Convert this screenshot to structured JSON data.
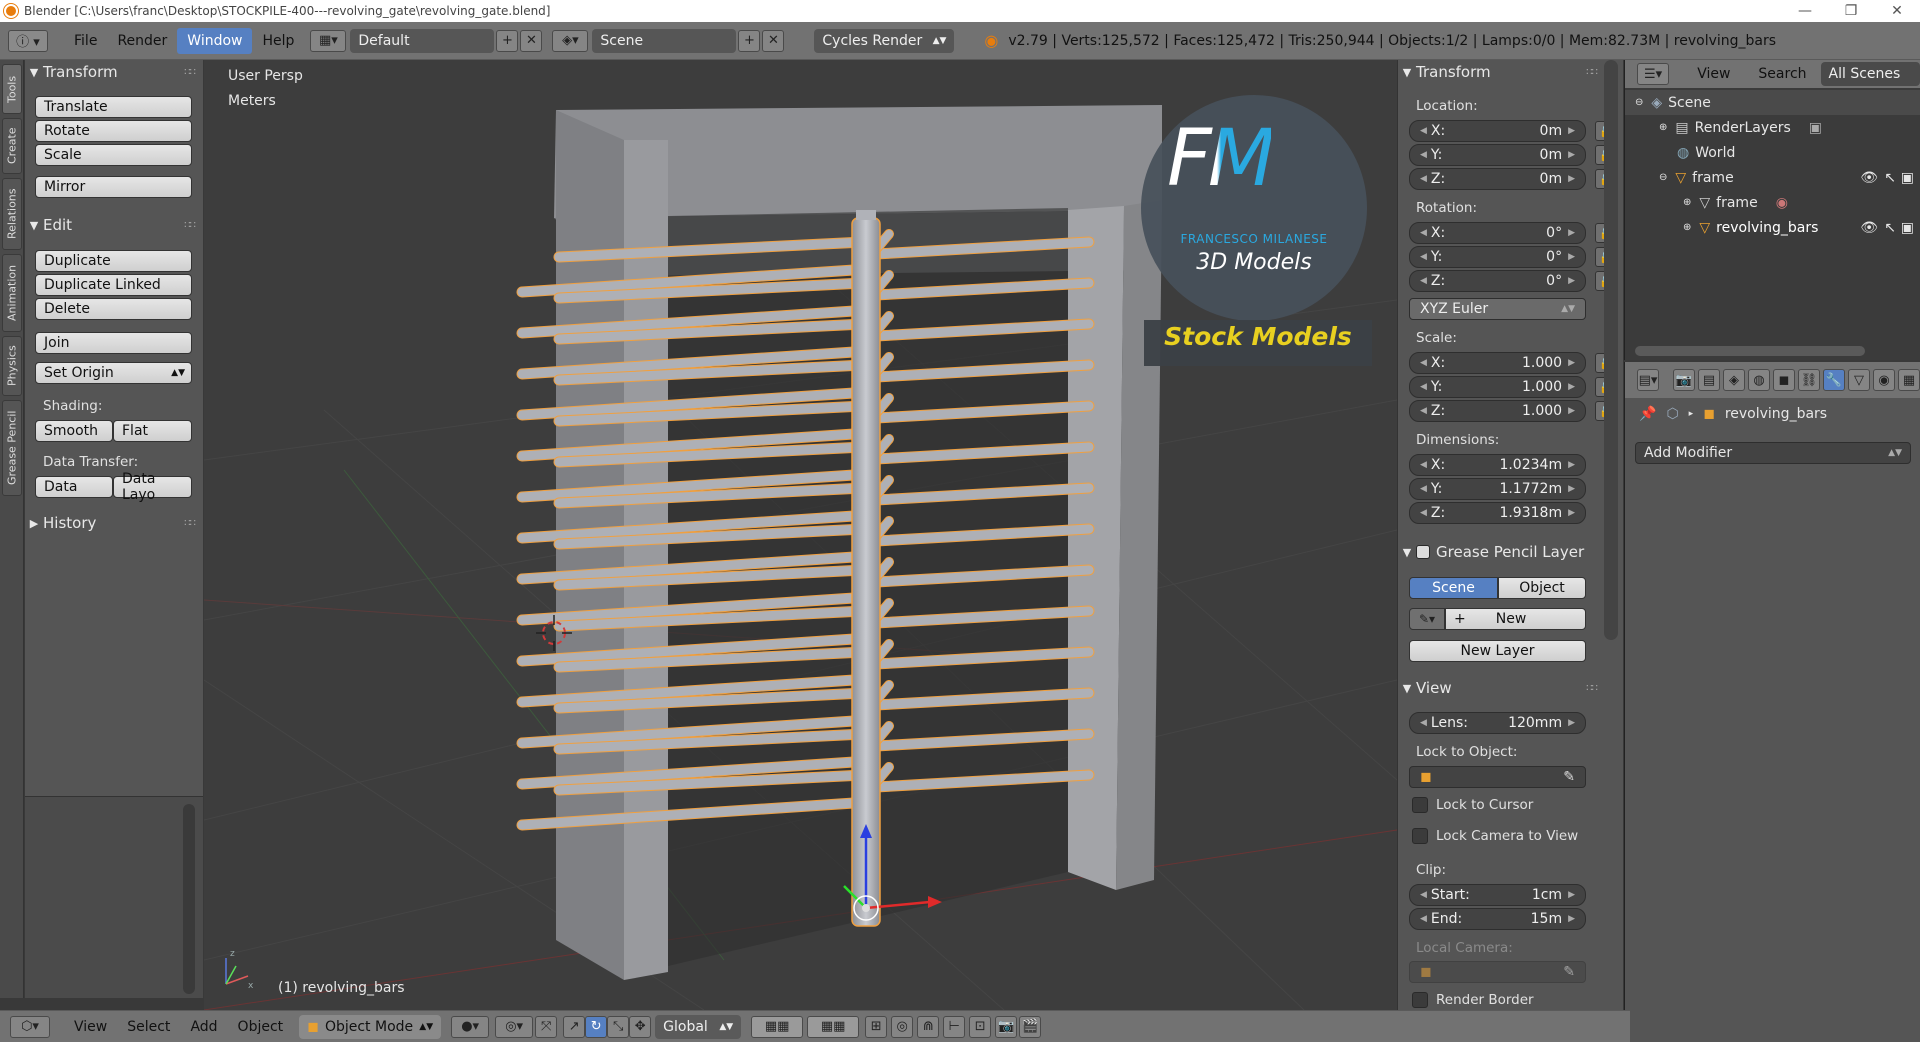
{
  "window": {
    "title": "Blender [C:\\Users\\franc\\Desktop\\STOCKPILE-400---revolving_gate\\revolving_gate.blend]",
    "controls": [
      "—",
      "❐",
      "✕"
    ]
  },
  "infobar": {
    "menus": [
      "File",
      "Render",
      "Window",
      "Help"
    ],
    "active_menu": "Window",
    "screen_layout": "Default",
    "scene": "Scene",
    "render_engine": "Cycles Render",
    "stats": "v2.79 | Verts:125,572 | Faces:125,472 | Tris:250,944 | Objects:1/2 | Lamps:0/0 | Mem:82.73M | revolving_bars"
  },
  "tool_tabs": [
    "Tools",
    "Create",
    "Relations",
    "Animation",
    "Physics",
    "Grease Pencil"
  ],
  "tools": {
    "transform_header": "Transform",
    "translate": "Translate",
    "rotate": "Rotate",
    "scale": "Scale",
    "mirror": "Mirror",
    "edit_header": "Edit",
    "duplicate": "Duplicate",
    "duplicate_linked": "Duplicate Linked",
    "delete": "Delete",
    "join": "Join",
    "set_origin": "Set Origin",
    "shading_label": "Shading:",
    "smooth": "Smooth",
    "flat": "Flat",
    "data_transfer_label": "Data Transfer:",
    "data": "Data",
    "data_layout": "Data Layo",
    "history_header": "History"
  },
  "viewport": {
    "view_name": "User Persp",
    "units": "Meters",
    "active_object": "(1) revolving_bars",
    "watermark_initials": "FM",
    "watermark_name": "FRANCESCO MILANESE",
    "watermark_sub": "3D Models",
    "watermark_banner": "Stock Models"
  },
  "bottombar": {
    "menus": [
      "View",
      "Select",
      "Add",
      "Object"
    ],
    "mode": "Object Mode",
    "orientation": "Global"
  },
  "npanel": {
    "transform_header": "Transform",
    "location_label": "Location:",
    "location": [
      {
        "k": "X:",
        "v": "0m"
      },
      {
        "k": "Y:",
        "v": "0m"
      },
      {
        "k": "Z:",
        "v": "0m"
      }
    ],
    "rotation_label": "Rotation:",
    "rotation": [
      {
        "k": "X:",
        "v": "0°"
      },
      {
        "k": "Y:",
        "v": "0°"
      },
      {
        "k": "Z:",
        "v": "0°"
      }
    ],
    "rotation_mode": "XYZ Euler",
    "scale_label": "Scale:",
    "scale": [
      {
        "k": "X:",
        "v": "1.000"
      },
      {
        "k": "Y:",
        "v": "1.000"
      },
      {
        "k": "Z:",
        "v": "1.000"
      }
    ],
    "dimensions_label": "Dimensions:",
    "dimensions": [
      {
        "k": "X:",
        "v": "1.0234m"
      },
      {
        "k": "Y:",
        "v": "1.1772m"
      },
      {
        "k": "Z:",
        "v": "1.9318m"
      }
    ],
    "grease_header": "Grease Pencil Layer",
    "scene_btn": "Scene",
    "object_btn": "Object",
    "new_btn": "New",
    "new_layer_btn": "New Layer",
    "view_header": "View",
    "lens_label": "Lens:",
    "lens_value": "120mm",
    "lock_object_label": "Lock to Object:",
    "lock_cursor": "Lock to Cursor",
    "lock_camera": "Lock Camera to View",
    "clip_label": "Clip:",
    "clip_start_label": "Start:",
    "clip_start": "1cm",
    "clip_end_label": "End:",
    "clip_end": "15m",
    "local_camera_label": "Local Camera:",
    "render_border": "Render Border"
  },
  "outliner": {
    "view": "View",
    "search": "Search",
    "filter": "All Scenes",
    "items": [
      "Scene",
      "RenderLayers",
      "World",
      "frame",
      "frame",
      "revolving_bars"
    ]
  },
  "properties": {
    "object_name": "revolving_bars",
    "add_modifier": "Add Modifier"
  },
  "colors": {
    "accent": "#5680c2",
    "selection_outline": "#f0a040",
    "watermark_cyan": "#2aa9e0",
    "watermark_yellow": "#e8d020"
  }
}
